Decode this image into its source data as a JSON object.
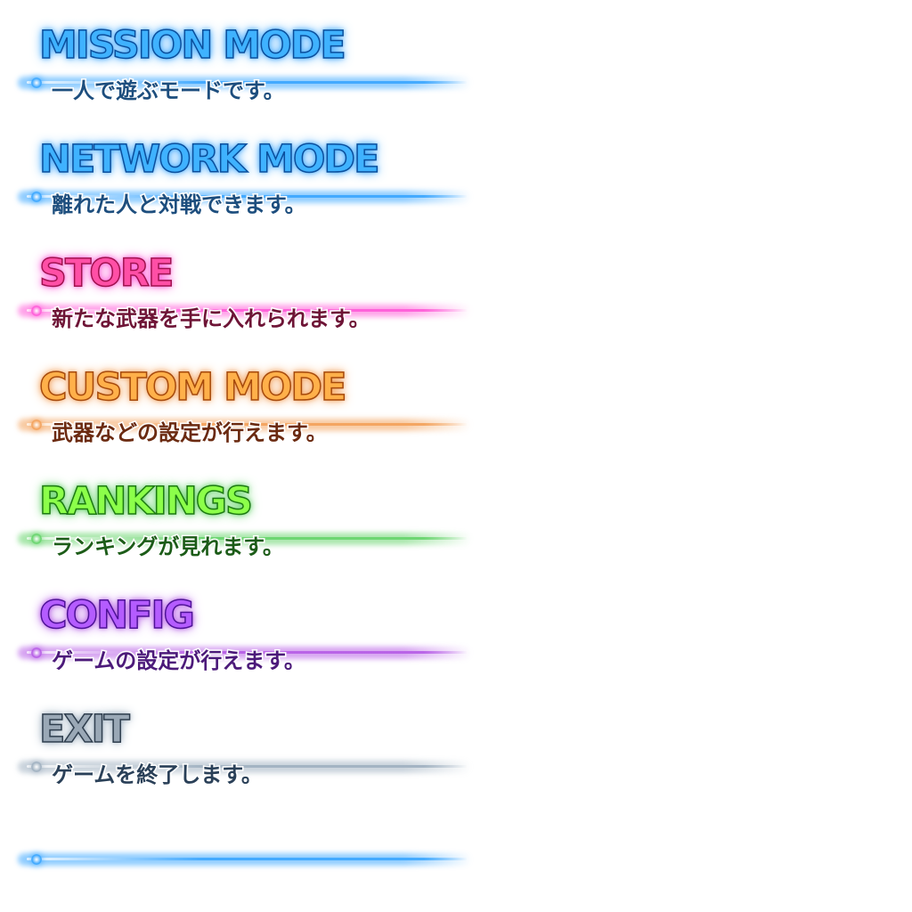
{
  "menu": {
    "items": [
      {
        "id": "mission-mode",
        "title": "MISSION MODE",
        "description": "一人で遊ぶモードです。",
        "title_color": "#3fb2ff",
        "title_stroke": "#0b4f9c",
        "glow_color": "#3aa6ff",
        "desc_color": "#1d4e7e"
      },
      {
        "id": "network-mode",
        "title": "NETWORK MODE",
        "description": "離れた人と対戦できます。",
        "title_color": "#3fb2ff",
        "title_stroke": "#0b4f9c",
        "glow_color": "#3aa6ff",
        "desc_color": "#1d4e7e"
      },
      {
        "id": "store",
        "title": "STORE",
        "description": "新たな武器を手に入れられます。",
        "title_color": "#ff4fa6",
        "title_stroke": "#a0124f",
        "glow_color": "#ff5ad8",
        "desc_color": "#6e1436"
      },
      {
        "id": "custom-mode",
        "title": "CUSTOM MODE",
        "description": "武器などの設定が行えます。",
        "title_color": "#ffb04a",
        "title_stroke": "#a64a0c",
        "glow_color": "#f3a15a",
        "desc_color": "#6b2a10"
      },
      {
        "id": "rankings",
        "title": "RANKINGS",
        "description": "ランキングが見れます。",
        "title_color": "#8cff4a",
        "title_stroke": "#1d7a12",
        "glow_color": "#66d46b",
        "desc_color": "#1c5c18"
      },
      {
        "id": "config",
        "title": "CONFIG",
        "description": "ゲームの設定が行えます。",
        "title_color": "#b45cff",
        "title_stroke": "#4e1296",
        "glow_color": "#b65ce6",
        "desc_color": "#4c1a7a"
      },
      {
        "id": "exit",
        "title": "EXIT",
        "description": "ゲームを終了します。",
        "title_color": "#9aa8b6",
        "title_stroke": "#2f3e4e",
        "glow_color": "#9fb0c0",
        "desc_color": "#2a4058"
      }
    ],
    "bottom_line_color": "#3aa6ff"
  }
}
